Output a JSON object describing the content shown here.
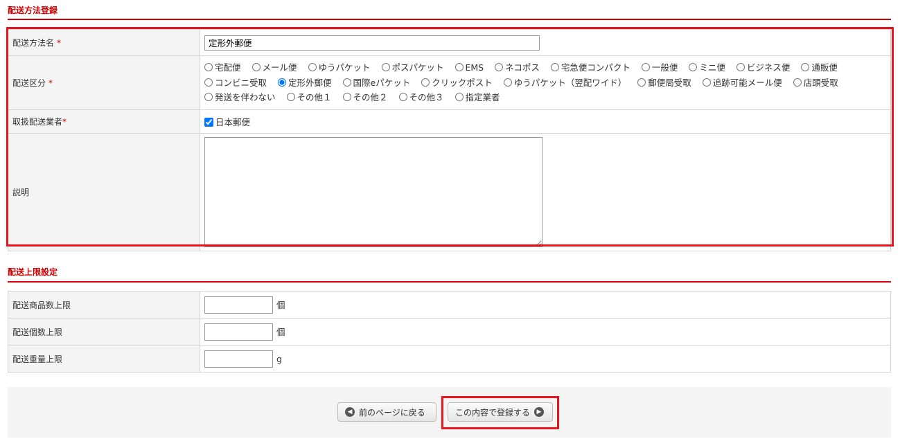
{
  "section1": {
    "title": "配送方法登録",
    "name_label": "配送方法名",
    "name_value": "定形外郵便",
    "required": "*",
    "kubun_label": "配送区分",
    "kubun_options": [
      "宅配便",
      "メール便",
      "ゆうパケット",
      "ポスパケット",
      "EMS",
      "ネコポス",
      "宅急便コンパクト",
      "一般便",
      "ミニ便",
      "ビジネス便",
      "通販便",
      "コンビニ受取",
      "定形外郵便",
      "国際eパケット",
      "クリックポスト",
      "ゆうパケット（翌配ワイド）",
      "郵便局受取",
      "追跡可能メール便",
      "店頭受取",
      "発送を伴わない",
      "その他１",
      "その他２",
      "その他３",
      "指定業者"
    ],
    "kubun_selected": "定形外郵便",
    "carrier_label": "取扱配送業者",
    "carrier_option": "日本郵便",
    "carrier_checked": true,
    "desc_label": "説明",
    "desc_value": ""
  },
  "section2": {
    "title": "配送上限設定",
    "rows": [
      {
        "label": "配送商品数上限",
        "value": "",
        "unit": "個"
      },
      {
        "label": "配送個数上限",
        "value": "",
        "unit": "個"
      },
      {
        "label": "配送重量上限",
        "value": "",
        "unit": "g"
      }
    ]
  },
  "buttons": {
    "back": "前のページに戻る",
    "submit": "この内容で登録する"
  }
}
